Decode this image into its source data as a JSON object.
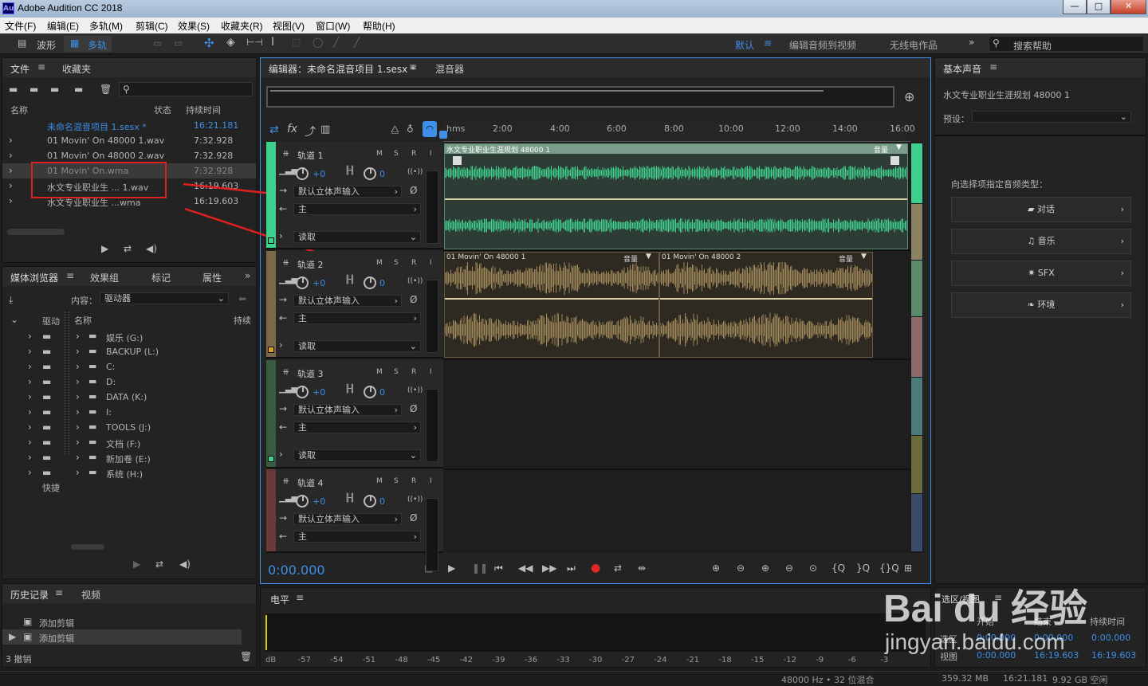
{
  "window": {
    "app_badge": "Au",
    "title": "Adobe Audition CC 2018",
    "btn_min": "—",
    "btn_max": "□",
    "btn_close": "✕"
  },
  "menu": [
    "文件(F)",
    "编辑(E)",
    "多轨(M)",
    "剪辑(C)",
    "效果(S)",
    "收藏夹(R)",
    "视图(V)",
    "窗口(W)",
    "帮助(H)"
  ],
  "toolbar": {
    "waveform": "波形",
    "multitrack": "多轨",
    "workspace_default": "默认",
    "workspace_edit_video": "编辑音频到视频",
    "workspace_radio": "无线电作品",
    "search_help": "搜索帮助"
  },
  "files_panel": {
    "tab_files": "文件",
    "tab_favorites": "收藏夹",
    "col_name": "名称",
    "col_status": "状态",
    "col_duration": "持续时间",
    "rows": [
      {
        "name": "未命名混音项目 1.sesx *",
        "duration": "16:21.181"
      },
      {
        "name": "01 Movin' On 48000 1.wav",
        "duration": "7:32.928"
      },
      {
        "name": "01 Movin' On 48000 2.wav",
        "duration": "7:32.928"
      },
      {
        "name": "01 Movin' On.wma",
        "duration": "7:32.928"
      },
      {
        "name": "水文专业职业生 ... 1.wav",
        "duration": "16:19.603"
      },
      {
        "name": "水文专业职业生 ...wma",
        "duration": "16:19.603"
      }
    ]
  },
  "media_panel": {
    "tab_media": "媒体浏览器",
    "tab_effects": "效果组",
    "tab_markers": "标记",
    "tab_props": "属性",
    "content_label": "内容：",
    "content_value": "驱动器",
    "col_name": "名称",
    "col_duration": "持续",
    "left_drive": "驱动",
    "left_shortcut": "快捷",
    "drives": [
      "娱乐 (G:)",
      "BACKUP (L:)",
      "C:",
      "D:",
      "DATA (K:)",
      "I:",
      "TOOLS (J:)",
      "文档 (F:)",
      "新加卷 (E:)",
      "系统 (H:)"
    ]
  },
  "history_panel": {
    "tab_history": "历史记录",
    "tab_video": "视频",
    "items": [
      "添加剪辑",
      "添加剪辑"
    ],
    "undo": "3 撤销"
  },
  "editor": {
    "tab_editor": "编辑器：未命名混音项目 1.sesx *",
    "tab_mixer": "混音器",
    "timecode": "0:00.000",
    "ruler": [
      "hms",
      "2:00",
      "4:00",
      "6:00",
      "8:00",
      "10:00",
      "12:00",
      "14:00",
      "16:00"
    ],
    "tracks": [
      {
        "name": "轨道 1",
        "m": "M",
        "s": "S",
        "r": "R",
        "vol": "+0",
        "pan": "0",
        "input": "默认立体声输入",
        "output": "主",
        "mode": "读取",
        "color": "#3fcf8e"
      },
      {
        "name": "轨道 2",
        "m": "M",
        "s": "S",
        "r": "R",
        "vol": "+0",
        "pan": "0",
        "input": "默认立体声输入",
        "output": "主",
        "mode": "读取",
        "color": "#e0a020"
      },
      {
        "name": "轨道 3",
        "m": "M",
        "s": "S",
        "r": "R",
        "vol": "+0",
        "pan": "0",
        "input": "默认立体声输入",
        "output": "主",
        "mode": "读取",
        "color": "#3fcf8e"
      },
      {
        "name": "轨道 4",
        "m": "M",
        "s": "S",
        "r": "R",
        "vol": "+0",
        "pan": "0",
        "input": "默认立体声输入",
        "output": "主",
        "mode": "",
        "color": "#c04040"
      }
    ],
    "clips": {
      "track1": "水文专业职业生涯规划 48000 1",
      "track1_vol": "音量",
      "track2a": "01 Movin' On 48000 1",
      "track2a_vol": "音量",
      "track2b": "01 Movin' On 48000 2",
      "track2b_vol": "音量"
    }
  },
  "levels": {
    "title": "电平",
    "scale": [
      "dB",
      "-57",
      "-54",
      "-51",
      "-48",
      "-45",
      "-42",
      "-39",
      "-36",
      "-33",
      "-30",
      "-27",
      "-24",
      "-21",
      "-18",
      "-15",
      "-12",
      "-9",
      "-6",
      "-3"
    ]
  },
  "essential_sound": {
    "title": "基本声音",
    "clip": "水文专业职业生涯规划 48000 1",
    "preset_label": "预设：",
    "assign_label": "向选择项指定音频类型：",
    "types": [
      "对话",
      "音乐",
      "SFX",
      "环境"
    ]
  },
  "selection_panel": {
    "title": "选区/视图",
    "col_start": "开始",
    "col_end": "结束",
    "col_duration": "持续时间",
    "row_sel": "选区",
    "row_view": "视图",
    "sel_start": "0:00.000",
    "sel_end": "0:00.000",
    "sel_dur": "0:00.000",
    "view_start": "0:00.000",
    "view_end": "16:19.603",
    "view_dur": "16:19.603"
  },
  "status": {
    "format": "48000 Hz • 32 位混合",
    "mem": "359.32 MB",
    "dur": "16:21.181",
    "free": "9.92 GB 空闲"
  },
  "watermark": {
    "brand": "Bai du 经验",
    "url": "jingyan.baidu.com"
  },
  "colors": {
    "accent": "#3d8fe8",
    "clip_green": "#3fcf8e",
    "clip_gold": "#a08858",
    "arrow_red": "#e02020"
  }
}
